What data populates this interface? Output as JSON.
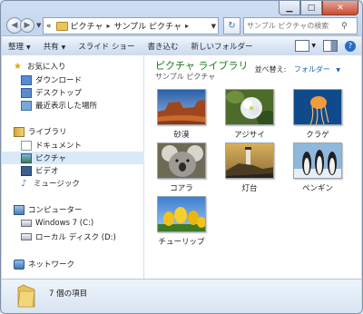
{
  "window": {
    "address": [
      "ピクチャ",
      "サンプル ピクチャ"
    ],
    "address_prefix": "«",
    "search_placeholder": "サンプル ピクチャの検索"
  },
  "toolbar": {
    "organize": "整理",
    "share": "共有",
    "slideshow": "スライド ショー",
    "burn": "書き込む",
    "new_folder": "新しいフォルダー"
  },
  "sidebar": {
    "favorites": "お気に入り",
    "downloads": "ダウンロード",
    "desktop": "デスクトップ",
    "recent": "最近表示した場所",
    "libraries": "ライブラリ",
    "documents": "ドキュメント",
    "pictures": "ピクチャ",
    "videos": "ビデオ",
    "music": "ミュージック",
    "computer": "コンピューター",
    "drive_c": "Windows 7 (C:)",
    "drive_d": "ローカル ディスク (D:)",
    "network": "ネットワーク"
  },
  "content": {
    "title": "ピクチャ ライブラリ",
    "subtitle": "サンプル ピクチャ",
    "arrange_label": "並べ替え:",
    "arrange_value": "フォルダー",
    "items": [
      {
        "name": "砂漠"
      },
      {
        "name": "アジサイ"
      },
      {
        "name": "クラゲ"
      },
      {
        "name": "コアラ"
      },
      {
        "name": "灯台"
      },
      {
        "name": "ペンギン"
      },
      {
        "name": "チューリップ"
      }
    ]
  },
  "status": {
    "count_text": "7 個の項目"
  },
  "colors": {
    "library_title": "#1e7a1e",
    "link_blue": "#1f5fae",
    "selection": "#d9e9f8"
  }
}
